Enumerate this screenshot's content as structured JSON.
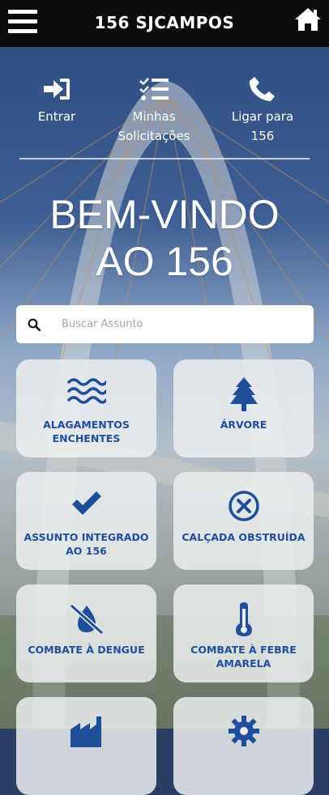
{
  "header": {
    "title": "156 SJCAMPOS"
  },
  "quick_actions": {
    "entrar": "Entrar",
    "minhas_line1": "Minhas",
    "minhas_line2": "Solicitações",
    "ligar_line1": "Ligar para",
    "ligar_line2": "156"
  },
  "welcome": {
    "line1": "BEM-VINDO",
    "line2": "AO 156"
  },
  "search": {
    "placeholder": "Buscar Assunto"
  },
  "cards": [
    {
      "line1": "ALAGAMENTOS",
      "line2": "ENCHENTES",
      "icon": "water-waves-icon"
    },
    {
      "line1": "ÁRVORE",
      "line2": "",
      "icon": "tree-icon"
    },
    {
      "line1": "ASSUNTO INTEGRADO",
      "line2": "AO 156",
      "icon": "check-icon"
    },
    {
      "line1": "CALÇADA OBSTRUÍDA",
      "line2": "",
      "icon": "blocked-circle-icon"
    },
    {
      "line1": "COMBATE À DENGUE",
      "line2": "",
      "icon": "no-water-drop-icon"
    },
    {
      "line1": "COMBATE À FEBRE",
      "line2": "AMARELA",
      "icon": "thermometer-icon"
    },
    {
      "line1": "",
      "line2": "",
      "icon": "factory-icon"
    },
    {
      "line1": "",
      "line2": "",
      "icon": "gear-icon"
    }
  ],
  "colors": {
    "topbar": "#0b0b0c",
    "card_text": "#1f4f9b",
    "card_bg": "#eceef0"
  }
}
